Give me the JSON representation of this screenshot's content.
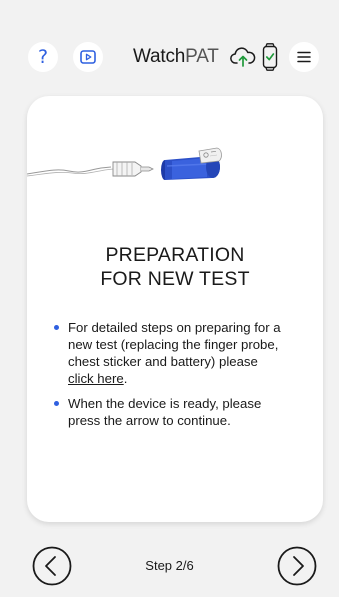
{
  "header": {
    "brand_watch": "Watch",
    "brand_pat": "PAT",
    "help_glyph": "?",
    "icons": {
      "help": "question-mark-icon",
      "video": "video-play-icon",
      "cloud": "cloud-upload-icon",
      "watch": "watch-check-icon",
      "menu": "hamburger-menu-icon"
    }
  },
  "card": {
    "image": "device-with-finger-probe-illustration",
    "title_line1": "PREPARATION",
    "title_line2": "FOR NEW TEST",
    "bullet1_lines": [
      "For detailed steps on preparing for a",
      "new test (replacing the finger probe,",
      "chest sticker and battery) please"
    ],
    "bullet1_link": "click here",
    "bullet1_tail": ".",
    "bullet2_lines": [
      "When the device is ready, please",
      "press the arrow to continue."
    ]
  },
  "footer": {
    "step_label": "Step 2/6",
    "prev_icon": "chevron-left-circle-icon",
    "next_icon": "chevron-right-circle-icon"
  },
  "colors": {
    "accent": "#2f60e0",
    "background": "#f2f2f2",
    "card": "#ffffff",
    "text": "#1a1a1a",
    "device_blue": "#2c50c8"
  }
}
